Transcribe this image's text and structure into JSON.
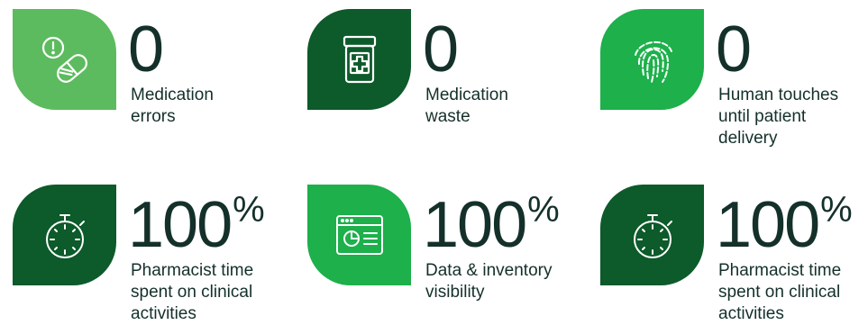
{
  "colors": {
    "light_green": "#5cbb5e",
    "dark_green": "#0d5a2a",
    "bright_green": "#1db04b",
    "text": "#14302a"
  },
  "stats": [
    {
      "value": "0",
      "unit": "",
      "label": "Medication\nerrors",
      "icon": "alert-pill-icon",
      "tile_color": "light-green"
    },
    {
      "value": "0",
      "unit": "",
      "label": "Medication\nwaste",
      "icon": "medicine-jar-icon",
      "tile_color": "dark-green"
    },
    {
      "value": "0",
      "unit": "",
      "label": "Human touches\nuntil patient\ndelivery",
      "icon": "fingerprint-icon",
      "tile_color": "bright-green"
    },
    {
      "value": "100",
      "unit": "%",
      "label": "Pharmacist time\nspent on clinical\nactivities",
      "icon": "stopwatch-icon",
      "tile_color": "dark-green"
    },
    {
      "value": "100",
      "unit": "%",
      "label": "Data & inventory\nvisibility",
      "icon": "dashboard-window-icon",
      "tile_color": "bright-green"
    },
    {
      "value": "100",
      "unit": "%",
      "label": "Pharmacist time\nspent on clinical\nactivities",
      "icon": "stopwatch-icon",
      "tile_color": "dark-green"
    }
  ]
}
